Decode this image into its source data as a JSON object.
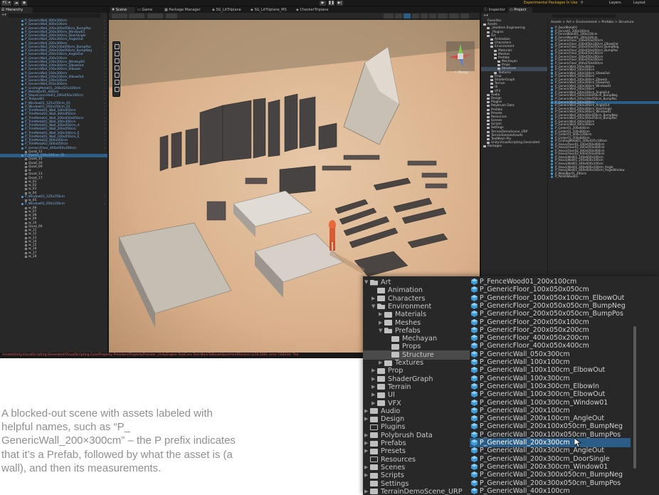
{
  "menubar": {
    "account_label": "FC ▾",
    "play_icon": "play-icon",
    "pause_icon": "pause-icon",
    "step_icon": "step-icon",
    "experimental_label": "Experimental Packages In Use ▾",
    "layers_label": "Layers",
    "layout_label": "Layout"
  },
  "hierarchy": {
    "tab": "Hierarchy",
    "items": [
      {
        "label": "P_GenericWall_400x300cm",
        "type": "prefab"
      },
      {
        "label": "P_GenericWall_400x100cm",
        "type": "prefab"
      },
      {
        "label": "P_GenericWall_200x300x050cm_BumpPos",
        "type": "prefab"
      },
      {
        "label": "P_GenericWall_200x300cm_Window01",
        "type": "prefab"
      },
      {
        "label": "P_GenericWall_200x300cm_DoorSingle",
        "type": "prefab"
      },
      {
        "label": "P_GenericWall_200x300cm_AngleOut",
        "type": "prefab"
      },
      {
        "label": "P_GenericWall_200x300cm",
        "type": "prefab"
      },
      {
        "label": "P_GenericWall_200x100x050cm_BumpPos",
        "type": "prefab"
      },
      {
        "label": "P_GenericWall_200x100x050cm_BumpNeg",
        "type": "prefab"
      },
      {
        "label": "P_GenericWall_200x100cm_AngleOut",
        "type": "prefab"
      },
      {
        "label": "P_GenericWall_200x100cm",
        "type": "prefab"
      },
      {
        "label": "P_GenericWall_100x300cm_Window01",
        "type": "prefab"
      },
      {
        "label": "P_GenericWall_100x300cm_ElbowOut",
        "type": "prefab"
      },
      {
        "label": "P_GenericWall_100x300cm_ElbowIn",
        "type": "prefab"
      },
      {
        "label": "P_GenericWall_100x300cm",
        "type": "prefab"
      },
      {
        "label": "P_GenericWall_100x100cm_ElbowOut",
        "type": "prefab"
      },
      {
        "label": "P_GenericWall_100x100cm",
        "type": "prefab"
      },
      {
        "label": "P_GenericWall_050x300cm",
        "type": "prefab"
      },
      {
        "label": "P_GratingMetal01_200x025x100cm",
        "type": "prefab"
      },
      {
        "label": "P_MetalBar01_400cm",
        "type": "prefab"
      },
      {
        "label": "P_StepsConcrete01_200x050x100cm",
        "type": "prefab"
      },
      {
        "label": "P_Telepod01",
        "type": "prefab"
      },
      {
        "label": "P_Window01_125x150cm_01",
        "type": "prefab"
      },
      {
        "label": "P_Window01_050x150cm_01",
        "type": "prefab"
      },
      {
        "label": "P_TrimMetal01_Wall_100x050cm",
        "type": "prefab"
      },
      {
        "label": "P_TrimMetal01_Wall_400x050cm",
        "type": "prefab"
      },
      {
        "label": "P_TrimMetal01_Wall_200x050x050cm",
        "type": "prefab"
      },
      {
        "label": "P_TrimMetal01_Wall_200x300cm",
        "type": "prefab"
      },
      {
        "label": "P_TrimMetal01_Wall_200x050cm_A",
        "type": "prefab"
      },
      {
        "label": "P_TrimMetal01_Wall_200x050cm",
        "type": "prefab"
      },
      {
        "label": "P_TrimMetal01_Wall_100x100cm_E",
        "type": "prefab"
      },
      {
        "label": "P_TrimMetal01_Wall_100x050cm_E",
        "type": "prefab"
      },
      {
        "label": "P_TrimMetal02_800x050cm",
        "type": "prefab"
      },
      {
        "label": "P_TrimMetal02_600x050cm",
        "type": "prefab"
      },
      {
        "label": "P_GenericFloor_400x050x200cm",
        "type": "prefab"
      },
      {
        "label": "Quad_12",
        "type": "object"
      },
      {
        "label": "P_Pipe01_030x200cm_01",
        "type": "prefab",
        "selected": true
      },
      {
        "label": "Quad_15",
        "type": "object"
      },
      {
        "label": "Quad_16",
        "type": "object"
      },
      {
        "label": "Quad_09",
        "type": "object"
      },
      {
        "label": "w",
        "type": "object"
      },
      {
        "label": "Quad_13",
        "type": "object"
      },
      {
        "label": "Quad_17",
        "type": "object"
      },
      {
        "label": "w_01",
        "type": "object"
      },
      {
        "label": "w_02",
        "type": "object"
      },
      {
        "label": "w_03",
        "type": "object"
      },
      {
        "label": "w_04",
        "type": "object"
      },
      {
        "label": "P_Window01_125x150cm",
        "type": "prefab"
      },
      {
        "label": "w_05",
        "type": "object"
      },
      {
        "label": "P_Window01_050x150cm",
        "type": "prefab"
      },
      {
        "label": "w_06",
        "type": "object"
      },
      {
        "label": "w_07",
        "type": "object"
      },
      {
        "label": "w_08",
        "type": "object"
      },
      {
        "label": "w_09",
        "type": "object"
      },
      {
        "label": "w_10",
        "type": "object"
      },
      {
        "label": "Quad_06",
        "type": "object"
      },
      {
        "label": "w_11",
        "type": "object"
      },
      {
        "label": "w_12",
        "type": "object"
      },
      {
        "label": "w_13",
        "type": "object"
      },
      {
        "label": "w_14",
        "type": "object"
      },
      {
        "label": "w_15",
        "type": "object"
      },
      {
        "label": "w_16",
        "type": "object"
      },
      {
        "label": "w_17",
        "type": "object"
      },
      {
        "label": "w_18",
        "type": "object"
      }
    ]
  },
  "scene": {
    "tabs": [
      "Scene",
      "Game",
      "Package Manager",
      "SG_LitTriplane",
      "SG_LitTriplane_MS",
      "CheckerTriplane"
    ],
    "active_tab": "Scene",
    "persp_label": "< Persp"
  },
  "inspector": {
    "tabs": [
      "Inspector",
      "Project"
    ],
    "active_tab": "Project"
  },
  "project": {
    "favorites_label": "Favorites",
    "breadcrumb": "Assets > Art > Environment > Prefabs > Structure",
    "tree": [
      {
        "label": "Favorites",
        "indent": 0
      },
      {
        "label": "Assets",
        "indent": 0
      },
      {
        "label": "_Heathen Engineering",
        "indent": 1
      },
      {
        "label": "_Plugins",
        "indent": 1
      },
      {
        "label": "Art",
        "indent": 1
      },
      {
        "label": "Animation",
        "indent": 2
      },
      {
        "label": "Characters",
        "indent": 2
      },
      {
        "label": "Environment",
        "indent": 2
      },
      {
        "label": "Materials",
        "indent": 3
      },
      {
        "label": "Meshes",
        "indent": 3
      },
      {
        "label": "Prefabs",
        "indent": 3
      },
      {
        "label": "Mechayan",
        "indent": 4
      },
      {
        "label": "Props",
        "indent": 4
      },
      {
        "label": "Structure",
        "indent": 4,
        "selected": true
      },
      {
        "label": "Textures",
        "indent": 3
      },
      {
        "label": "Prop",
        "indent": 2
      },
      {
        "label": "ShaderGraph",
        "indent": 2
      },
      {
        "label": "Terrain",
        "indent": 2
      },
      {
        "label": "UI",
        "indent": 2
      },
      {
        "label": "VFX",
        "indent": 2
      },
      {
        "label": "Audio",
        "indent": 1
      },
      {
        "label": "Design",
        "indent": 1
      },
      {
        "label": "Plugins",
        "indent": 1
      },
      {
        "label": "Polybrush Data",
        "indent": 1
      },
      {
        "label": "Prefabs",
        "indent": 1
      },
      {
        "label": "Presets",
        "indent": 1
      },
      {
        "label": "Resources",
        "indent": 1
      },
      {
        "label": "Scenes",
        "indent": 1
      },
      {
        "label": "Scripts",
        "indent": 1
      },
      {
        "label": "Settings",
        "indent": 1
      },
      {
        "label": "TerrainDemoScene_URP",
        "indent": 1
      },
      {
        "label": "TerrainSampleAssets",
        "indent": 1
      },
      {
        "label": "TextMesh Pro",
        "indent": 1
      },
      {
        "label": "Unity.VisualScripting.Generated",
        "indent": 1
      },
      {
        "label": "Packages",
        "indent": 0
      }
    ],
    "files": [
      "P_DockMetal01",
      "P_Fence01_200x100cm",
      "P_FenceWood01_100x100cm",
      "P_FenceWood01_200x100cm",
      "P_GenericFloor_100x050x050cm",
      "P_GenericFloor_100x050x100cm_ElbowOut",
      "P_GenericFloor_200x050x050cm_BumpNeg",
      "P_GenericFloor_200x050x050cm_BumpPos",
      "P_GenericFloor_200x050x100cm",
      "P_GenericFloor_200x050x200cm",
      "P_GenericFloor_400x050x200cm",
      "P_GenericFloor_400x050x400cm",
      "P_GenericWall_050x300cm",
      "P_GenericWall_100x100cm",
      "P_GenericWall_100x100cm_ElbowOut",
      "P_GenericWall_100x300cm",
      "P_GenericWall_100x300cm_ElbowIn",
      "P_GenericWall_100x300cm_ElbowOut",
      "P_GenericWall_100x300cm_Window01",
      "P_GenericWall_200x100cm",
      "P_GenericWall_200x100cm_AngleOut",
      "P_GenericWall_200x100x050cm_BumpNeg",
      "P_GenericWall_200x100x050cm_BumpPos",
      "P_GenericWall_200x300cm",
      "P_GenericWall_200x300cm_AngleOut",
      "P_GenericWall_200x300cm_DoorSingle",
      "P_GenericWall_200x300cm_Window01",
      "P_GenericWall_200x300x050cm_BumpNeg",
      "P_GenericWall_200x300x050cm_BumpPos",
      "P_GenericWall_400x100cm",
      "P_GenericWall_400x300cm",
      "P_Girder01_200x600cm",
      "P_Girder01_200x800cm",
      "P_Girder01_400x1200cm",
      "P_Girder01_200x600cm",
      "P_GratingMetal01_200x025x100cm",
      "P_HeavyFloor01_200x050x400cm",
      "P_HeavyFloor01_400x050x400cm",
      "P_HeavyFloor02_400x050x400cm",
      "P_HeavyFloor02_600x050x400cm",
      "P_HeavyWall01_100x600x100cm",
      "P_HeavyWall01_200x600x100cm",
      "P_HeavyWall01_400x600x100cm",
      "P_HeavyWall01_400x600x100cm_Angle",
      "P_HeavyWall01_400x600x100cm_AngleWindow",
      "P_MetalBar01_400cm",
      "P_PalletWood01"
    ],
    "selected_file_index": 23
  },
  "console": {
    "message": "Assets/Unity.VisualScripting.Generated/VisualScripting.Core/Property Providers/PropertyProvider_UnityEngine.TextCore.Text.MarkToBaseAdjustmentRecord.cs(16,160): error CS0234: The"
  },
  "inset": {
    "tree": [
      {
        "label": "Art",
        "indent": 0,
        "state": "open"
      },
      {
        "label": "Animation",
        "indent": 1,
        "state": "closed",
        "arrow": false
      },
      {
        "label": "Characters",
        "indent": 1,
        "state": "closed",
        "arrow": true
      },
      {
        "label": "Environment",
        "indent": 1,
        "state": "open",
        "arrow": true
      },
      {
        "label": "Materials",
        "indent": 2,
        "state": "closed",
        "arrow": true
      },
      {
        "label": "Meshes",
        "indent": 2,
        "state": "closed",
        "arrow": true
      },
      {
        "label": "Prefabs",
        "indent": 2,
        "state": "open",
        "arrow": true
      },
      {
        "label": "Mechayan",
        "indent": 3,
        "state": "closed",
        "arrow": false
      },
      {
        "label": "Props",
        "indent": 3,
        "state": "closed",
        "arrow": false
      },
      {
        "label": "Structure",
        "indent": 3,
        "state": "closed",
        "arrow": false,
        "selected": true
      },
      {
        "label": "Textures",
        "indent": 2,
        "state": "closed",
        "arrow": true
      },
      {
        "label": "Prop",
        "indent": 1,
        "state": "closed",
        "arrow": true
      },
      {
        "label": "ShaderGraph",
        "indent": 1,
        "state": "closed",
        "arrow": true
      },
      {
        "label": "Terrain",
        "indent": 1,
        "state": "closed",
        "arrow": true
      },
      {
        "label": "UI",
        "indent": 1,
        "state": "closed",
        "arrow": true
      },
      {
        "label": "VFX",
        "indent": 1,
        "state": "closed",
        "arrow": true
      },
      {
        "label": "Audio",
        "indent": 0,
        "state": "closed",
        "arrow": true
      },
      {
        "label": "Design",
        "indent": 0,
        "state": "closed",
        "arrow": true
      },
      {
        "label": "Plugins",
        "indent": 0,
        "state": "empty",
        "arrow": false
      },
      {
        "label": "Polybrush Data",
        "indent": 0,
        "state": "closed",
        "arrow": true
      },
      {
        "label": "Prefabs",
        "indent": 0,
        "state": "closed",
        "arrow": true
      },
      {
        "label": "Presets",
        "indent": 0,
        "state": "closed",
        "arrow": true
      },
      {
        "label": "Resources",
        "indent": 0,
        "state": "empty",
        "arrow": false
      },
      {
        "label": "Scenes",
        "indent": 0,
        "state": "closed",
        "arrow": true
      },
      {
        "label": "Scripts",
        "indent": 0,
        "state": "closed",
        "arrow": true
      },
      {
        "label": "Settings",
        "indent": 0,
        "state": "closed",
        "arrow": false
      },
      {
        "label": "TerrainDemoScene_URP",
        "indent": 0,
        "state": "closed",
        "arrow": true
      }
    ],
    "files": [
      "P_FenceWood01_200x100cm",
      "P_GenericFloor_100x050x050cm",
      "P_GenericFloor_100x050x100cm_ElbowOut",
      "P_GenericFloor_200x050x050cm_BumpNeg",
      "P_GenericFloor_200x050x050cm_BumpPos",
      "P_GenericFloor_200x050x100cm",
      "P_GenericFloor_200x050x200cm",
      "P_GenericFloor_400x050x200cm",
      "P_GenericFloor_400x050x400cm",
      "P_GenericWall_050x300cm",
      "P_GenericWall_100x100cm",
      "P_GenericWall_100x100cm_ElbowOut",
      "P_GenericWall_100x300cm",
      "P_GenericWall_100x300cm_ElbowIn",
      "P_GenericWall_100x300cm_ElbowOut",
      "P_GenericWall_100x300cm_Window01",
      "P_GenericWall_200x100cm",
      "P_GenericWall_200x100cm_AngleOut",
      "P_GenericWall_200x100x050cm_BumpNeg",
      "P_GenericWall_200x100x050cm_BumpPos",
      "P_GenericWall_200x300cm",
      "P_GenericWall_200x300cm_AngleOut",
      "P_GenericWall_200x300cm_DoorSingle",
      "P_GenericWall_200x300cm_Window01",
      "P_GenericWall_200x300x050cm_BumpNeg",
      "P_GenericWall_200x300x050cm_BumpPos",
      "P_GenericWall_400x100cm"
    ],
    "selected_file_index": 20
  },
  "caption": {
    "text": "A blocked-out scene with assets labeled with helpful names, such as “P_ GenericWall_200×300cm” – the P prefix indicates that it’s a Prefab, followed by what the asset is (a wall), and then its measurements."
  },
  "colors": {
    "editor_bg": "#282828",
    "selection": "#2c5d87",
    "prefab_icon": "#3d9ad6",
    "experimental": "#e3b428",
    "error": "#e05b5b",
    "caption": "#8f8f8f"
  }
}
